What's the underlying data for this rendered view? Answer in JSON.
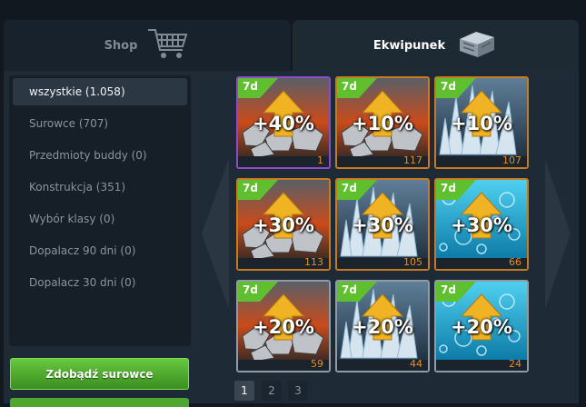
{
  "tabs": {
    "shop": "Shop",
    "inventory": "Ekwipunek"
  },
  "categories": [
    {
      "label": "wszystkie (1.058)"
    },
    {
      "label": "Surowce (707)"
    },
    {
      "label": "Przedmioty buddy (0)"
    },
    {
      "label": "Konstrukcja (351)"
    },
    {
      "label": "Wybór klasy (0)"
    },
    {
      "label": "Dopalacz 90 dni (0)"
    },
    {
      "label": "Dopalacz 30 dni (0)"
    }
  ],
  "buttons": {
    "get_resources": "Zdobądź surowce"
  },
  "items": [
    {
      "badge": "7d",
      "boost": "+40%",
      "qty": "1",
      "art": "ore",
      "rarity": "purple"
    },
    {
      "badge": "7d",
      "boost": "+10%",
      "qty": "117",
      "art": "ore",
      "rarity": "orange"
    },
    {
      "badge": "7d",
      "boost": "+10%",
      "qty": "107",
      "art": "crystal",
      "rarity": "orange"
    },
    {
      "badge": "7d",
      "boost": "+30%",
      "qty": "113",
      "art": "ore",
      "rarity": "orange"
    },
    {
      "badge": "7d",
      "boost": "+30%",
      "qty": "105",
      "art": "crystal",
      "rarity": "orange"
    },
    {
      "badge": "7d",
      "boost": "+30%",
      "qty": "66",
      "art": "water",
      "rarity": "orange"
    },
    {
      "badge": "7d",
      "boost": "+20%",
      "qty": "59",
      "art": "ore",
      "rarity": "gray"
    },
    {
      "badge": "7d",
      "boost": "+20%",
      "qty": "44",
      "art": "crystal",
      "rarity": "gray"
    },
    {
      "badge": "7d",
      "boost": "+20%",
      "qty": "24",
      "art": "water",
      "rarity": "gray"
    }
  ],
  "pagination": {
    "pages": [
      "1",
      "2",
      "3"
    ],
    "current": "1"
  },
  "colors": {
    "badge_green": "#5fbf2e",
    "quantity_orange": "#e98b1f",
    "boost_arrow": "#f0b323",
    "button_green": "#4fa82e"
  },
  "icons": {
    "shop_tab": "shopping-cart-icon",
    "inventory_tab": "metal-crate-icon",
    "left_nav": "chevron-left-icon",
    "right_nav": "chevron-right-icon"
  }
}
